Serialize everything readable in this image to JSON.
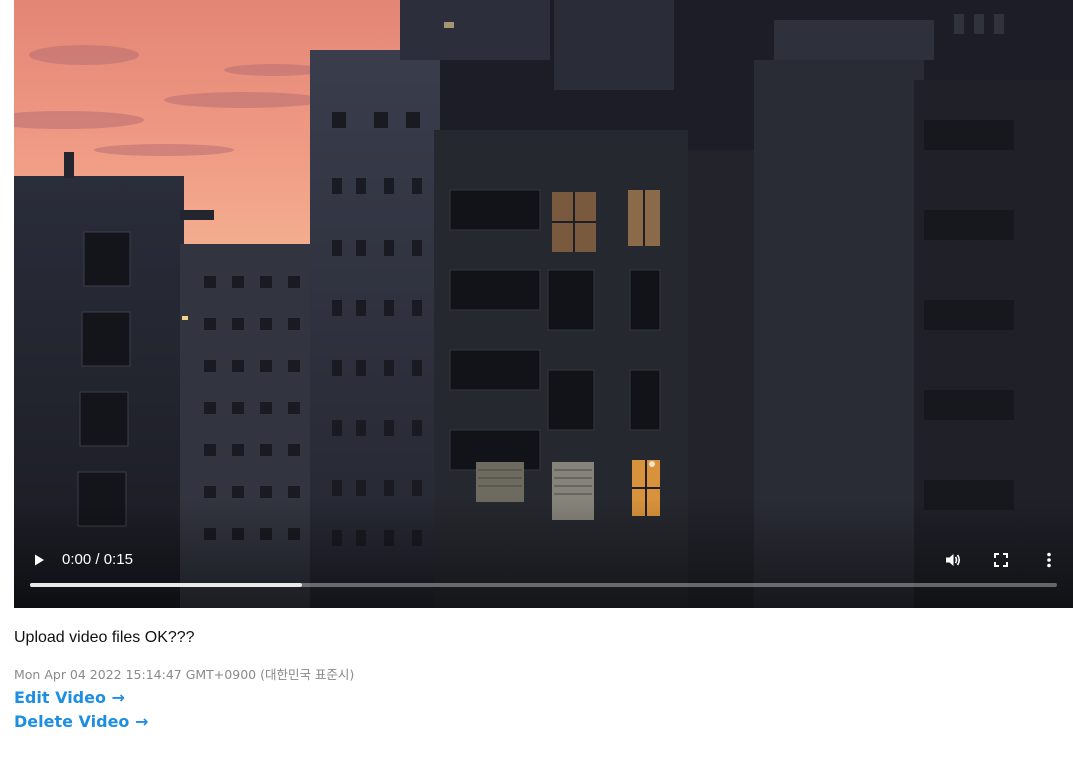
{
  "video_player": {
    "current_time": "0:00",
    "duration": "0:15",
    "time_separator": " / ",
    "buffered_fraction": 0.265,
    "play_icon": "play-icon",
    "volume_icon": "volume-icon",
    "fullscreen_icon": "fullscreen-icon",
    "menu_icon": "more-vertical-icon"
  },
  "video_info": {
    "title": "Upload video files OK???",
    "timestamp": "Mon Apr 04 2022 15:14:47 GMT+0900 (대한민국 표준시)"
  },
  "actions": {
    "edit_label": "Edit Video →",
    "delete_label": "Delete Video →"
  },
  "colors": {
    "link": "#1e8fe0",
    "timestamp": "#8a8a8a",
    "sky_top": "#e98c7c",
    "sky_bottom": "#f3a98b"
  }
}
